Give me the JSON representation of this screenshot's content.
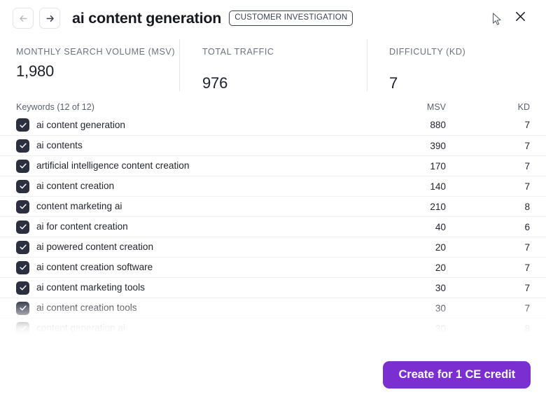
{
  "header": {
    "back_icon": "arrow-left-icon",
    "forward_icon": "arrow-right-icon",
    "title": "ai content generation",
    "badge": "CUSTOMER INVESTIGATION",
    "close_icon": "close-icon",
    "cursor_icon": "mouse-pointer-icon"
  },
  "metrics": [
    {
      "label": "MONTHLY SEARCH VOLUME (MSV)",
      "value": "1,980"
    },
    {
      "label": "TOTAL TRAFFIC",
      "value": "976"
    },
    {
      "label": "DIFFICULTY (KD)",
      "value": "7"
    }
  ],
  "keywords_panel": {
    "heading": "Keywords (12 of 12)",
    "col_msv": "MSV",
    "col_kd": "KD",
    "rows": [
      {
        "keyword": "ai content generation",
        "msv": "880",
        "kd": "7",
        "checked": true
      },
      {
        "keyword": "ai contents",
        "msv": "390",
        "kd": "7",
        "checked": true
      },
      {
        "keyword": "artificial intelligence content creation",
        "msv": "170",
        "kd": "7",
        "checked": true
      },
      {
        "keyword": "ai content creation",
        "msv": "140",
        "kd": "7",
        "checked": true
      },
      {
        "keyword": "content marketing ai",
        "msv": "210",
        "kd": "8",
        "checked": true
      },
      {
        "keyword": "ai for content creation",
        "msv": "40",
        "kd": "6",
        "checked": true
      },
      {
        "keyword": "ai powered content creation",
        "msv": "20",
        "kd": "7",
        "checked": true
      },
      {
        "keyword": "ai content creation software",
        "msv": "20",
        "kd": "7",
        "checked": true
      },
      {
        "keyword": "ai content marketing tools",
        "msv": "30",
        "kd": "7",
        "checked": true
      },
      {
        "keyword": "ai content creation tools",
        "msv": "30",
        "kd": "7",
        "checked": true
      },
      {
        "keyword": "content generation ai",
        "msv": "30",
        "kd": "8",
        "checked": true
      }
    ]
  },
  "footer": {
    "cta_label": "Create for 1 CE credit"
  },
  "colors": {
    "accent": "#7c2fd0",
    "checkbox": "#2b3040",
    "label": "#6d7280",
    "text": "#24262e"
  }
}
